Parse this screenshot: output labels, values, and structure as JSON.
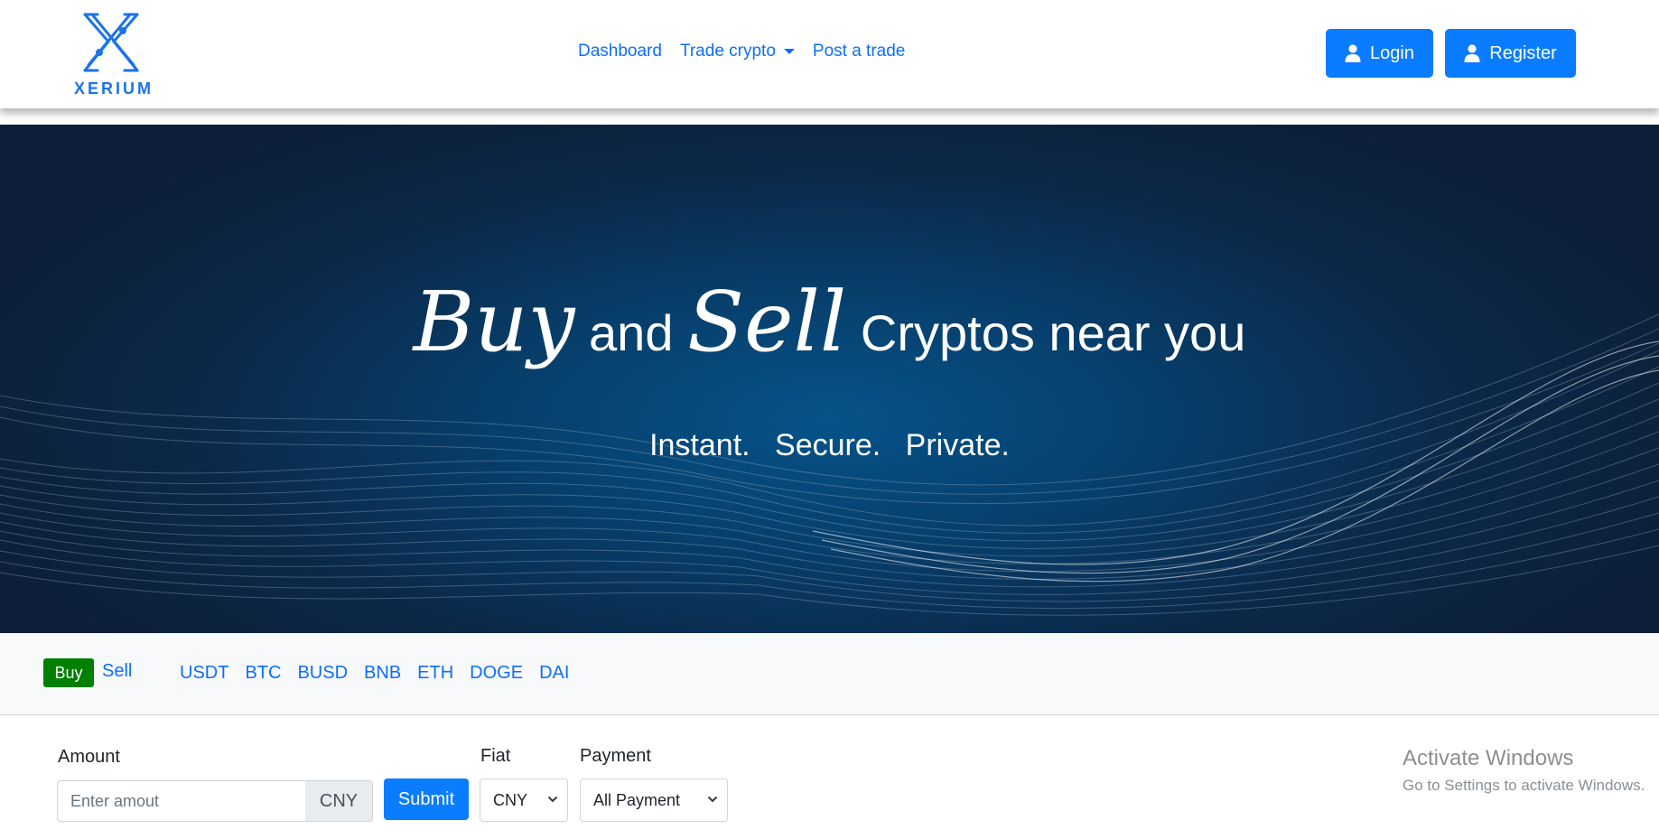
{
  "brand": {
    "name": "XERIUM",
    "color": "#1a73e8"
  },
  "nav": {
    "links": [
      {
        "label": "Dashboard"
      },
      {
        "label": "Trade crypto",
        "dropdown": true
      },
      {
        "label": "Post a trade"
      }
    ],
    "login_label": "Login",
    "register_label": "Register",
    "accent": "#0a7cff"
  },
  "hero": {
    "word1": "Buy",
    "word2": "and",
    "word3": "Sell",
    "word4": "Cryptos near you",
    "tagline": "Instant.  Secure.  Private."
  },
  "filter": {
    "buy_label": "Buy",
    "sell_label": "Sell",
    "buy_color": "#008000",
    "coins": [
      "USDT",
      "BTC",
      "BUSD",
      "BNB",
      "ETH",
      "DOGE",
      "DAI"
    ]
  },
  "form": {
    "amount_label": "Amount",
    "amount_placeholder": "Enter amout",
    "amount_currency": "CNY",
    "submit_label": "Submit",
    "fiat_label": "Fiat",
    "fiat_value": "CNY",
    "payment_label": "Payment",
    "payment_value": "All Payment"
  },
  "watermark": {
    "line1": "Activate Windows",
    "line2": "Go to Settings to activate Windows."
  }
}
